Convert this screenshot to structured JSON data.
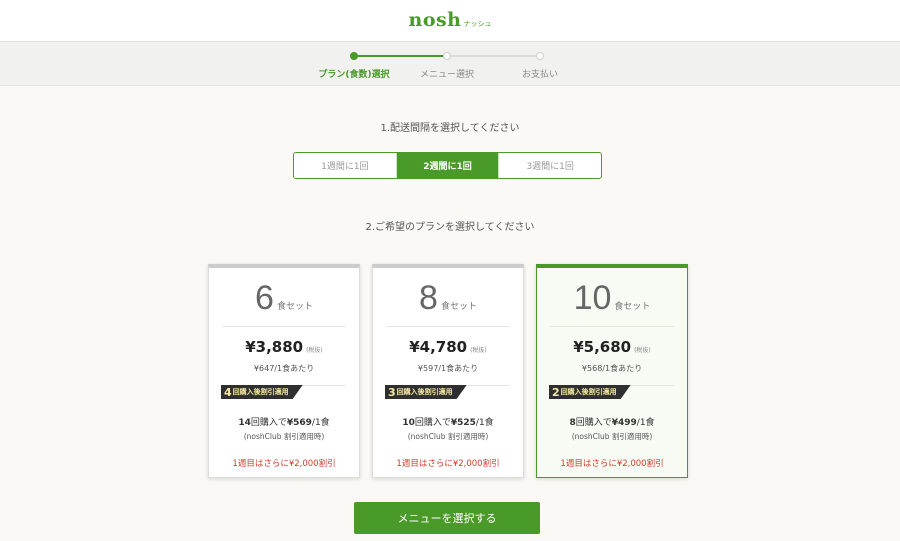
{
  "header": {
    "logo_main": "nosh",
    "logo_sub": "ナッシュ"
  },
  "steps": [
    {
      "label": "プラン(食数)選択",
      "active": true
    },
    {
      "label": "メニュー選択",
      "active": false
    },
    {
      "label": "お支払い",
      "active": false
    }
  ],
  "interval_section": {
    "title": "1.配送間隔を選択してください",
    "options": [
      {
        "label": "1週間に1回",
        "selected": false
      },
      {
        "label": "2週間に1回",
        "selected": true
      },
      {
        "label": "3週間に1回",
        "selected": false
      }
    ]
  },
  "plan_section": {
    "title": "2.ご希望のプランを選択してください",
    "plans": [
      {
        "count": "6",
        "unit": "食セット",
        "price": "¥3,880",
        "tax": "(税抜)",
        "per_meal": "¥647/1食あたり",
        "badge_num": "4",
        "badge_text": "回購入後割引適用",
        "club_times": "14",
        "club_mid": "回購入で",
        "club_price": "¥569",
        "club_suffix": "/1食",
        "club_note": "(noshClub 割引適用時)",
        "first_week": "1週目はさらに¥2,000割引",
        "selected": false
      },
      {
        "count": "8",
        "unit": "食セット",
        "price": "¥4,780",
        "tax": "(税抜)",
        "per_meal": "¥597/1食あたり",
        "badge_num": "3",
        "badge_text": "回購入後割引適用",
        "club_times": "10",
        "club_mid": "回購入で",
        "club_price": "¥525",
        "club_suffix": "/1食",
        "club_note": "(noshClub 割引適用時)",
        "first_week": "1週目はさらに¥2,000割引",
        "selected": false
      },
      {
        "count": "10",
        "unit": "食セット",
        "price": "¥5,680",
        "tax": "(税抜)",
        "per_meal": "¥568/1食あたり",
        "badge_num": "2",
        "badge_text": "回購入後割引適用",
        "club_times": "8",
        "club_mid": "回購入で",
        "club_price": "¥499",
        "club_suffix": "/1食",
        "club_note": "(noshClub 割引適用時)",
        "first_week": "1週目はさらに¥2,000割引",
        "selected": true
      }
    ]
  },
  "cta": {
    "label": "メニューを選択する"
  },
  "colors": {
    "brand": "#4a9a2a",
    "accent_red": "#d43a2a",
    "badge_bg": "#2f2f2f"
  }
}
